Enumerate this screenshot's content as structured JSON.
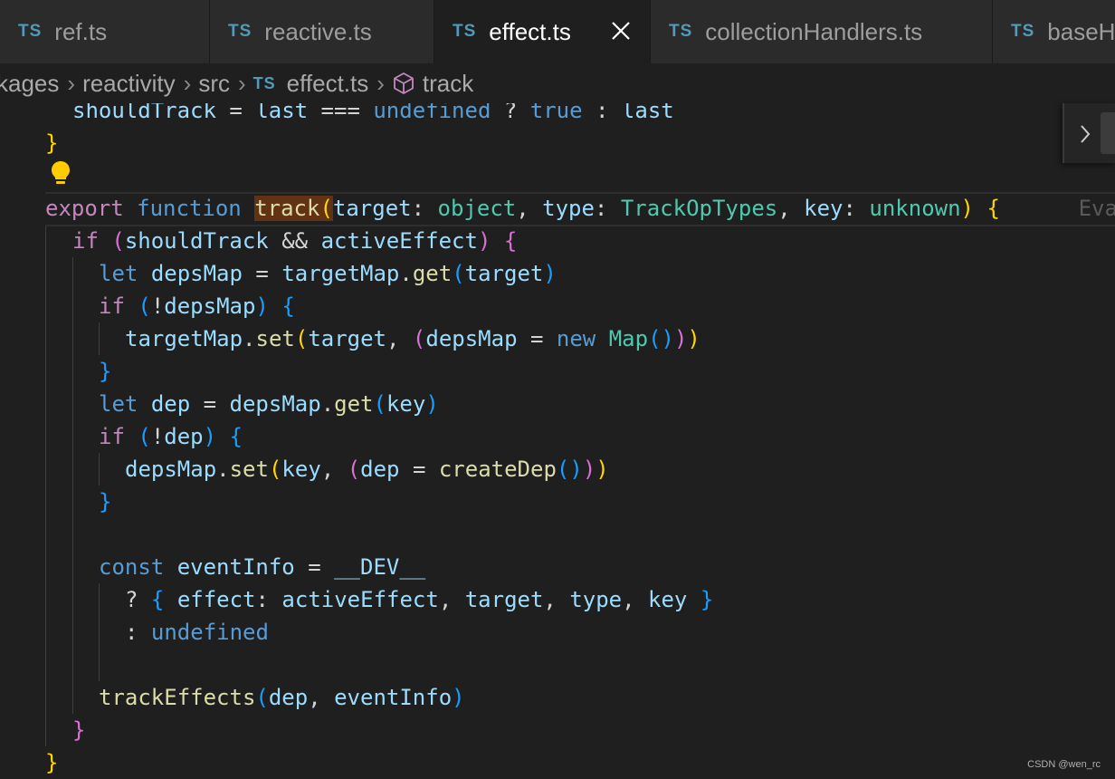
{
  "tabs": [
    {
      "badge": "TS",
      "label": "ref.ts"
    },
    {
      "badge": "TS",
      "label": "reactive.ts"
    },
    {
      "badge": "TS",
      "label": "effect.ts"
    },
    {
      "badge": "TS",
      "label": "collectionHandlers.ts"
    },
    {
      "badge": "TS",
      "label": "baseH"
    }
  ],
  "breadcrumb": {
    "items": [
      "kages",
      "reactivity",
      "src",
      "effect.ts",
      "track"
    ],
    "file_badge": "TS"
  },
  "code": {
    "l1": {
      "a": "shouldTrack",
      "b": " = ",
      "c": "last",
      "d": " === ",
      "e": "undefined",
      "f": " ? ",
      "g": "true",
      "h": " : ",
      "i": "last"
    },
    "l2": {
      "a": "}"
    },
    "l3": {
      "export": "export",
      "function": "function",
      "name": "track",
      "p1": "(",
      "target": "target",
      "c1": ": ",
      "object": "object",
      "cm1": ", ",
      "type": "type",
      "c2": ": ",
      "TrackOpTypes": "TrackOpTypes",
      "cm2": ", ",
      "key": "key",
      "c3": ": ",
      "unknown": "unknown",
      "p2": ")",
      "brace": "{",
      "hint": "Eva"
    },
    "l4": {
      "if": "if",
      "p1": "(",
      "shouldTrack": "shouldTrack",
      "and": " && ",
      "activeEffect": "activeEffect",
      "p2": ")",
      "brace": "{"
    },
    "l5": {
      "let": "let",
      "depsMap": "depsMap",
      "eq": " = ",
      "targetMap": "targetMap",
      "dot": ".",
      "get": "get",
      "p1": "(",
      "target": "target",
      "p2": ")"
    },
    "l6": {
      "if": "if",
      "p1": "(",
      "not": "!",
      "depsMap": "depsMap",
      "p2": ")",
      "brace": "{"
    },
    "l7": {
      "targetMap": "targetMap",
      "dot": ".",
      "set": "set",
      "p1": "(",
      "target": "target",
      "cm": ", ",
      "p2": "(",
      "depsMap": "depsMap",
      "eq": " = ",
      "new": "new",
      "Map": "Map",
      "p3": "()",
      "p4": ")",
      "p5": ")"
    },
    "l8": {
      "brace": "}"
    },
    "l9": {
      "let": "let",
      "dep": "dep",
      "eq": " = ",
      "depsMap": "depsMap",
      "dot": ".",
      "get": "get",
      "p1": "(",
      "key": "key",
      "p2": ")"
    },
    "l10": {
      "if": "if",
      "p1": "(",
      "not": "!",
      "dep": "dep",
      "p2": ")",
      "brace": "{"
    },
    "l11": {
      "depsMap": "depsMap",
      "dot": ".",
      "set": "set",
      "p1": "(",
      "key": "key",
      "cm": ", ",
      "p2": "(",
      "dep": "dep",
      "eq": " = ",
      "createDep": "createDep",
      "p3": "()",
      "p4": ")",
      "p5": ")"
    },
    "l12": {
      "brace": "}"
    },
    "l14": {
      "const": "const",
      "eventInfo": "eventInfo",
      "eq": " = ",
      "dev": "__DEV__"
    },
    "l15": {
      "q": "? ",
      "b1": "{",
      "effect": "effect",
      "c1": ": ",
      "activeEffect": "activeEffect",
      "cm1": ", ",
      "target": "target",
      "cm2": ", ",
      "type": "type",
      "cm3": ", ",
      "key": "key",
      "b2": "}"
    },
    "l16": {
      "colon": ": ",
      "undefined": "undefined"
    },
    "l18": {
      "trackEffects": "trackEffects",
      "p1": "(",
      "dep": "dep",
      "cm": ", ",
      "eventInfo": "eventInfo",
      "p2": ")"
    },
    "l19": {
      "brace": "}"
    },
    "l20": {
      "brace": "}"
    }
  },
  "watermark": "CSDN @wen_rc",
  "colors": {
    "accent_badge": "#519aba",
    "bracket_gold": "#ffd700",
    "bracket_pink": "#da70d6",
    "bracket_blue": "#179fff"
  }
}
